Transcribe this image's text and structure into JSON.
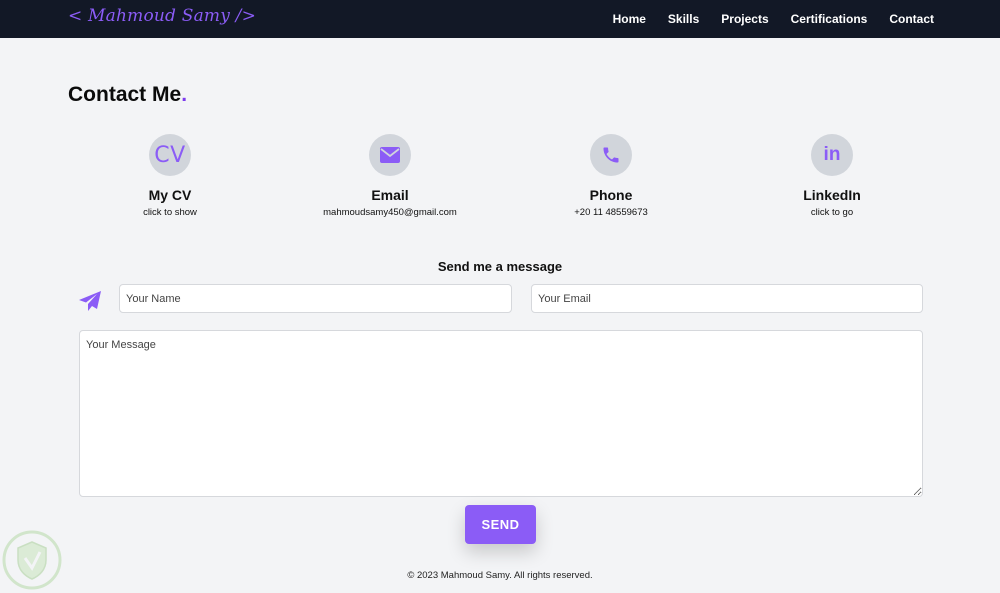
{
  "navbar": {
    "brand": "< Mahmoud Samy />",
    "links": [
      "Home",
      "Skills",
      "Projects",
      "Certifications",
      "Contact"
    ]
  },
  "contact": {
    "title": "Contact Me",
    "title_dot": ".",
    "cards": [
      {
        "icon": "cv-icon",
        "icon_text": "CV",
        "title": "My CV",
        "sub": "click to show"
      },
      {
        "icon": "envelope-icon",
        "title": "Email",
        "sub": "mahmoudsamy450@gmail.com"
      },
      {
        "icon": "phone-icon",
        "title": "Phone",
        "sub": "+20 11 48559673"
      },
      {
        "icon": "linkedin-icon",
        "icon_text": "in",
        "title": "LinkedIn",
        "sub": "click to go"
      }
    ]
  },
  "form": {
    "title": "Send me a message",
    "name_placeholder": "Your Name",
    "email_placeholder": "Your Email",
    "message_placeholder": "Your Message",
    "send_label": "SEND"
  },
  "footer": {
    "text": "© 2023 Mahmoud Samy. All rights reserved."
  },
  "colors": {
    "accent": "#8b5cf6",
    "navbar": "#121826",
    "background": "#f3f4f6"
  }
}
